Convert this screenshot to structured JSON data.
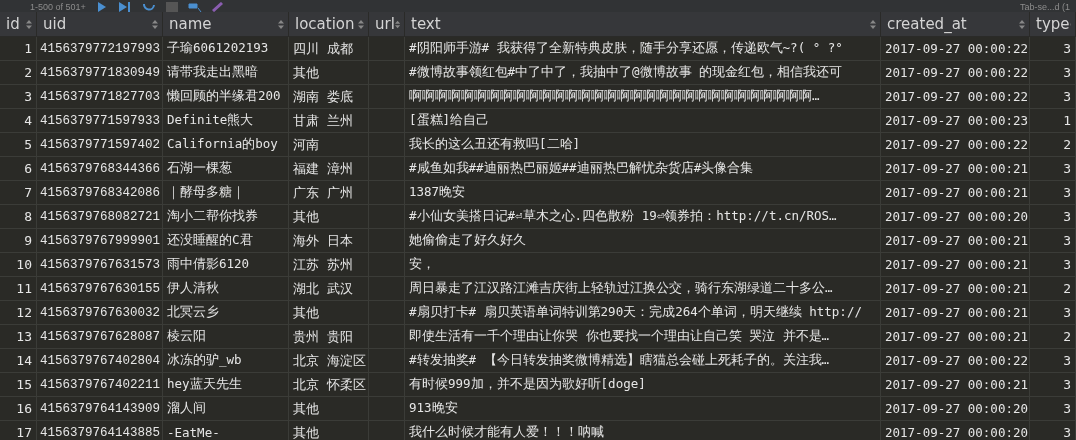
{
  "toolbar": {
    "page_range": "1-500 of 501+",
    "tab_label": "Tab-se...d (1"
  },
  "table": {
    "columns": [
      "id",
      "uid",
      "name",
      "location",
      "url",
      "text",
      "created_at",
      "type"
    ],
    "rows": [
      {
        "id": "1",
        "uid": "4156379772197993",
        "name": "子瑜6061202193",
        "location": "四川 成都",
        "url": "",
        "text": "#阴阳师手游# 我获得了全新特典皮肤，随手分享还愿，传递欧气~?( ° ?°",
        "created_at": "2017-09-27 00:00:22",
        "type": "3"
      },
      {
        "id": "2",
        "uid": "4156379771830949",
        "name": "请带我走出黑暗",
        "location": "其他",
        "url": "",
        "text": "#微博故事领红包#中了中了，我抽中了@微博故事 的现金红包，相信我还可",
        "created_at": "2017-09-27 00:00:22",
        "type": "3"
      },
      {
        "id": "3",
        "uid": "4156379771827703",
        "name": "懒回顾的半缘君200",
        "location": "湖南 娄底",
        "url": "",
        "text": "啊啊啊啊啊啊啊啊啊啊啊啊啊啊啊啊啊啊啊啊啊啊啊啊啊啊啊啊啊啊啊…",
        "created_at": "2017-09-27 00:00:22",
        "type": "3"
      },
      {
        "id": "4",
        "uid": "4156379771597933",
        "name": "Definite熊大",
        "location": "甘肃 兰州",
        "url": "",
        "text": "[蛋糕]给自己",
        "created_at": "2017-09-27 00:00:23",
        "type": "1"
      },
      {
        "id": "5",
        "uid": "4156379771597402",
        "name": "California的boy",
        "location": "河南",
        "url": "",
        "text": "我长的这么丑还有救吗[二哈]",
        "created_at": "2017-09-27 00:00:22",
        "type": "2"
      },
      {
        "id": "6",
        "uid": "4156379768344366",
        "name": "石湖一棵葱",
        "location": "福建 漳州",
        "url": "",
        "text": "#咸鱼如我##迪丽热巴丽姬##迪丽热巴解忧杂货店#头像合集",
        "created_at": "2017-09-27 00:00:21",
        "type": "3"
      },
      {
        "id": "7",
        "uid": "4156379768342086",
        "name": "｜酵母多糖｜",
        "location": "广东 广州",
        "url": "",
        "text": "1387晚安",
        "created_at": "2017-09-27 00:00:21",
        "type": "3"
      },
      {
        "id": "8",
        "uid": "4156379768082721",
        "name": "淘小二帮你找券",
        "location": "其他",
        "url": "",
        "text": "#小仙女美搭日记#⏎草木之心.四色散粉    19⏎领券拍：http://t.cn/ROS…",
        "created_at": "2017-09-27 00:00:20",
        "type": "3"
      },
      {
        "id": "9",
        "uid": "4156379767999901",
        "name": "还没睡醒的C君",
        "location": "海外 日本",
        "url": "",
        "text": "她偷偷走了好久好久",
        "created_at": "2017-09-27 00:00:21",
        "type": "3"
      },
      {
        "id": "10",
        "uid": "4156379767631573",
        "name": "雨中倩影6120",
        "location": "江苏 苏州",
        "url": "",
        "text": "安，",
        "created_at": "2017-09-27 00:00:21",
        "type": "3"
      },
      {
        "id": "11",
        "uid": "4156379767630155",
        "name": "伊人清秋",
        "location": "湖北 武汉",
        "url": "",
        "text": "周日暴走了江汉路江滩吉庆街上轻轨过江换公交，骑行东湖绿道二十多公…",
        "created_at": "2017-09-27 00:00:21",
        "type": "2"
      },
      {
        "id": "12",
        "uid": "4156379767630032",
        "name": "北冥云乡",
        "location": "其他",
        "url": "",
        "text": "#扇贝打卡# 扇贝英语单词特训第290天：完成264个单词，明天继续 http://",
        "created_at": "2017-09-27 00:00:21",
        "type": "3"
      },
      {
        "id": "13",
        "uid": "4156379767628087",
        "name": "棱云阳",
        "location": "贵州 贵阳",
        "url": "",
        "text": "即使生活有一千个理由让你哭 你也要找一个理由让自己笑 哭泣 并不是…",
        "created_at": "2017-09-27 00:00:21",
        "type": "2"
      },
      {
        "id": "14",
        "uid": "4156379767402804",
        "name": "冰冻的驴_wb",
        "location": "北京 海淀区",
        "url": "",
        "text": "#转发抽奖# 【今日转发抽奖微博精选】瞎猫总会碰上死耗子的。关注我…",
        "created_at": "2017-09-27 00:00:22",
        "type": "3"
      },
      {
        "id": "15",
        "uid": "4156379767402211",
        "name": "hey蓝天先生",
        "location": "北京 怀柔区",
        "url": "",
        "text": "有时候999加，并不是因为歌好听[doge]",
        "created_at": "2017-09-27 00:00:21",
        "type": "3"
      },
      {
        "id": "16",
        "uid": "4156379764143909",
        "name": "溜人间",
        "location": "其他",
        "url": "",
        "text": "913晚安",
        "created_at": "2017-09-27 00:00:20",
        "type": "3"
      },
      {
        "id": "17",
        "uid": "4156379764143885",
        "name": "-EatMe-",
        "location": "其他",
        "url": "",
        "text": "我什么时候才能有人爱！！！呐喊",
        "created_at": "2017-09-27 00:00:20",
        "type": "3"
      }
    ]
  }
}
